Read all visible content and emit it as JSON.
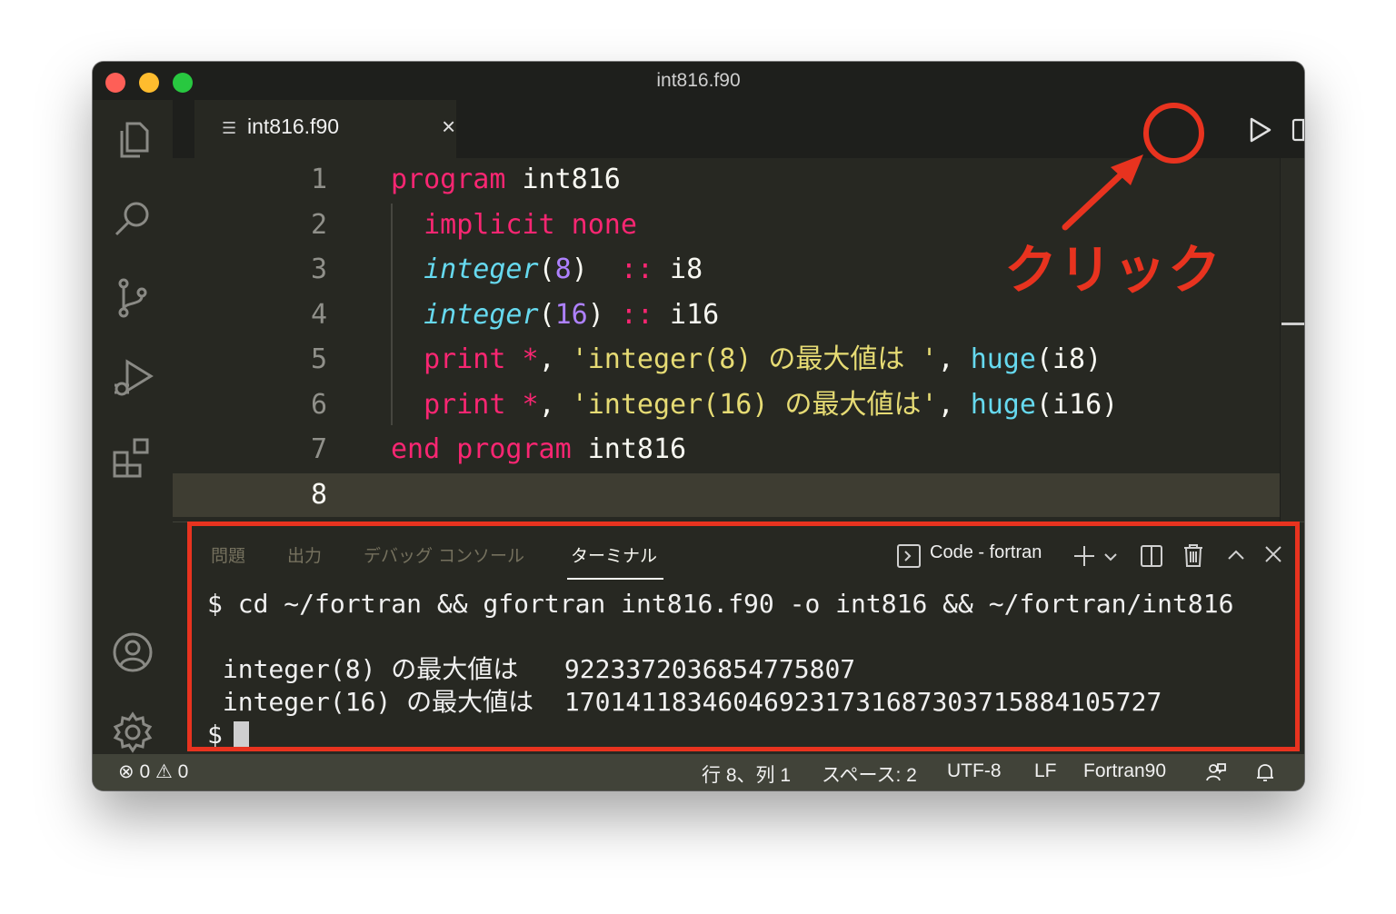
{
  "window": {
    "title": "int816.f90"
  },
  "tab": {
    "filename": "int816.f90",
    "icon": "hamburger-icon"
  },
  "editor": {
    "lines": [
      {
        "num": "1",
        "tokens": [
          [
            "kw",
            "program"
          ],
          [
            "plain",
            " int816"
          ]
        ]
      },
      {
        "num": "2",
        "tokens": [
          [
            "plain",
            "  "
          ],
          [
            "kw",
            "implicit none"
          ]
        ]
      },
      {
        "num": "3",
        "tokens": [
          [
            "plain",
            "  "
          ],
          [
            "ty",
            "integer"
          ],
          [
            "plain",
            "("
          ],
          [
            "num",
            "8"
          ],
          [
            "plain",
            ")  "
          ],
          [
            "kw",
            "::"
          ],
          [
            "plain",
            " i8"
          ]
        ]
      },
      {
        "num": "4",
        "tokens": [
          [
            "plain",
            "  "
          ],
          [
            "ty",
            "integer"
          ],
          [
            "plain",
            "("
          ],
          [
            "num",
            "16"
          ],
          [
            "plain",
            ") "
          ],
          [
            "kw",
            "::"
          ],
          [
            "plain",
            " i16"
          ]
        ]
      },
      {
        "num": "5",
        "tokens": [
          [
            "plain",
            "  "
          ],
          [
            "kw",
            "print"
          ],
          [
            "plain",
            " "
          ],
          [
            "kw",
            "*"
          ],
          [
            "plain",
            ", "
          ],
          [
            "str",
            "'integer(8) の最大値は '"
          ],
          [
            "plain",
            ", "
          ],
          [
            "fn",
            "huge"
          ],
          [
            "plain",
            "(i8)"
          ]
        ]
      },
      {
        "num": "6",
        "tokens": [
          [
            "plain",
            "  "
          ],
          [
            "kw",
            "print"
          ],
          [
            "plain",
            " "
          ],
          [
            "kw",
            "*"
          ],
          [
            "plain",
            ", "
          ],
          [
            "str",
            "'integer(16) の最大値は'"
          ],
          [
            "plain",
            ", "
          ],
          [
            "fn",
            "huge"
          ],
          [
            "plain",
            "(i16)"
          ]
        ]
      },
      {
        "num": "7",
        "tokens": [
          [
            "kw",
            "end program"
          ],
          [
            "plain",
            " int816"
          ]
        ]
      },
      {
        "num": "8",
        "tokens": []
      }
    ]
  },
  "annotation": {
    "label": "クリック"
  },
  "panel": {
    "tabs": [
      "問題",
      "出力",
      "デバッグ コンソール",
      "ターミナル"
    ],
    "active_tab": "ターミナル",
    "terminal_selector": "Code - fortran",
    "terminal_lines": [
      "$ cd ~/fortran && gfortran int816.f90 -o int816 && ~/fortran/int816",
      "",
      " integer(8) の最大値は   9223372036854775807",
      " integer(16) の最大値は  170141183460469231731687303715884105727",
      "$"
    ]
  },
  "status": {
    "errors": "0",
    "warnings": "0",
    "position": "行 8、列 1",
    "spaces": "スペース: 2",
    "encoding": "UTF-8",
    "eol": "LF",
    "language": "Fortran90"
  },
  "colors": {
    "accent_red": "#e8331f",
    "editor_bg": "#272822",
    "status_bg": "#414339"
  }
}
